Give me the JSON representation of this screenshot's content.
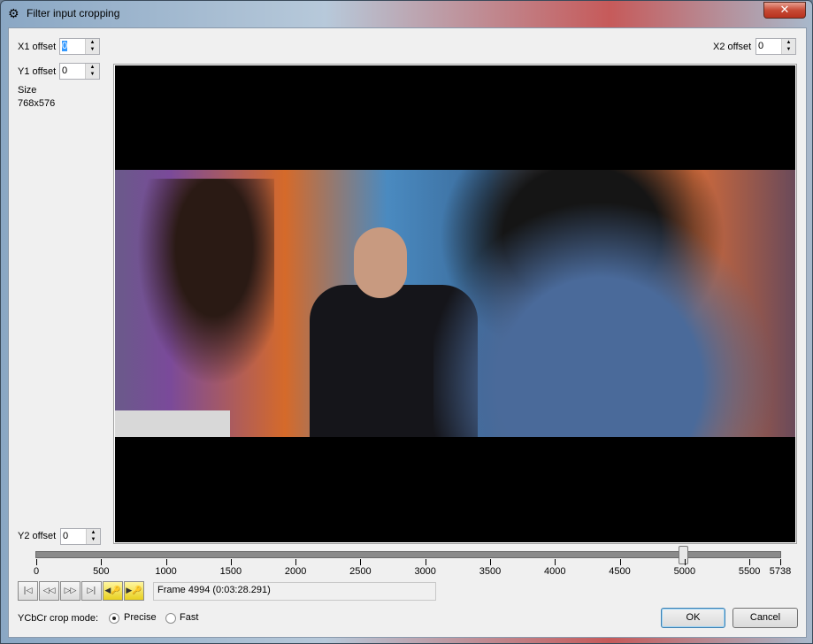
{
  "window": {
    "title": "Filter input cropping",
    "close_label": "✕"
  },
  "offsets": {
    "x1_label": "X1 offset",
    "x1_value": "0",
    "y1_label": "Y1 offset",
    "y1_value": "0",
    "x2_label": "X2 offset",
    "x2_value": "0",
    "y2_label": "Y2 offset",
    "y2_value": "0"
  },
  "size": {
    "label": "Size",
    "value": "768x576"
  },
  "timeline": {
    "min": 0,
    "max": 5738,
    "position": 4994,
    "ticks": [
      "0",
      "500",
      "1000",
      "1500",
      "2000",
      "2500",
      "3000",
      "3500",
      "4000",
      "4500",
      "5000",
      "5500",
      "5738"
    ]
  },
  "nav_buttons": [
    {
      "icon": "go-to-start-icon",
      "glyph": "|◁"
    },
    {
      "icon": "step-back-icon",
      "glyph": "◁◁"
    },
    {
      "icon": "step-forward-icon",
      "glyph": "▷▷"
    },
    {
      "icon": "go-to-end-icon",
      "glyph": "▷|"
    },
    {
      "icon": "prev-keyframe-icon",
      "glyph": "◀🔑"
    },
    {
      "icon": "next-keyframe-icon",
      "glyph": "▶🔑"
    }
  ],
  "frame_info": "Frame 4994 (0:03:28.291)",
  "crop_mode": {
    "label": "YCbCr crop mode:",
    "options": [
      "Precise",
      "Fast"
    ],
    "selected": "Precise"
  },
  "buttons": {
    "ok": "OK",
    "cancel": "Cancel"
  }
}
